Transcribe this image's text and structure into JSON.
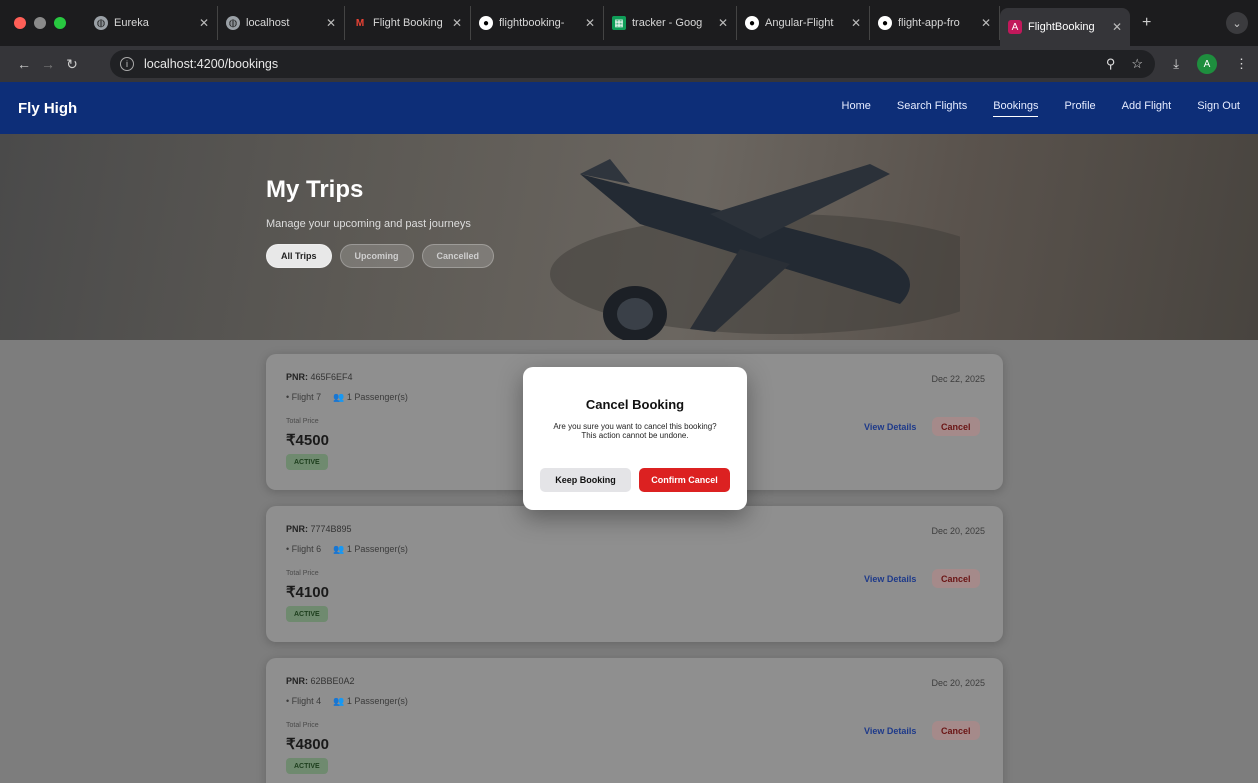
{
  "browser": {
    "tabs": [
      {
        "title": "Eureka",
        "icon": "globe-icon",
        "active": false
      },
      {
        "title": "localhost",
        "icon": "globe-icon",
        "active": false
      },
      {
        "title": "Flight Booking",
        "icon": "gmail-icon",
        "active": false
      },
      {
        "title": "flightbooking-",
        "icon": "github-icon",
        "active": false
      },
      {
        "title": "tracker - Goog",
        "icon": "sheets-icon",
        "active": false
      },
      {
        "title": "Angular-Flight",
        "icon": "github-icon",
        "active": false
      },
      {
        "title": "flight-app-fro",
        "icon": "github-icon",
        "active": false
      },
      {
        "title": "FlightBooking",
        "icon": "angular-icon",
        "active": true
      }
    ],
    "url": "localhost:4200/bookings",
    "avatar_letter": "A"
  },
  "app": {
    "brand": "Fly High",
    "nav": [
      "Home",
      "Search Flights",
      "Bookings",
      "Profile",
      "Add Flight",
      "Sign Out"
    ],
    "active_nav": "Bookings"
  },
  "hero": {
    "title": "My Trips",
    "subtitle": "Manage your upcoming and past journeys",
    "filters": [
      "All Trips",
      "Upcoming",
      "Cancelled"
    ],
    "active_filter": "All Trips"
  },
  "bookings": [
    {
      "pnr_label": "PNR:",
      "pnr": "465F6EF4",
      "flight": "• Flight 7",
      "passengers": "1 Passenger(s)",
      "price_label": "Total Price",
      "price": "₹4500",
      "status": "ACTIVE",
      "date": "Dec 22, 2025",
      "view_label": "View Details",
      "cancel_label": "Cancel"
    },
    {
      "pnr_label": "PNR:",
      "pnr": "7774B895",
      "flight": "• Flight 6",
      "passengers": "1 Passenger(s)",
      "price_label": "Total Price",
      "price": "₹4100",
      "status": "ACTIVE",
      "date": "Dec 20, 2025",
      "view_label": "View Details",
      "cancel_label": "Cancel"
    },
    {
      "pnr_label": "PNR:",
      "pnr": "62BBE0A2",
      "flight": "• Flight 4",
      "passengers": "1 Passenger(s)",
      "price_label": "Total Price",
      "price": "₹4800",
      "status": "ACTIVE",
      "date": "Dec 20, 2025",
      "view_label": "View Details",
      "cancel_label": "Cancel"
    }
  ],
  "modal": {
    "title": "Cancel Booking",
    "message": "Are you sure you want to cancel this booking?",
    "warning": "This action cannot be undone.",
    "keep_label": "Keep Booking",
    "confirm_label": "Confirm Cancel"
  },
  "colors": {
    "nav": "#0d2e78",
    "danger": "#dc2121",
    "status_active": "#1d3e1d"
  }
}
